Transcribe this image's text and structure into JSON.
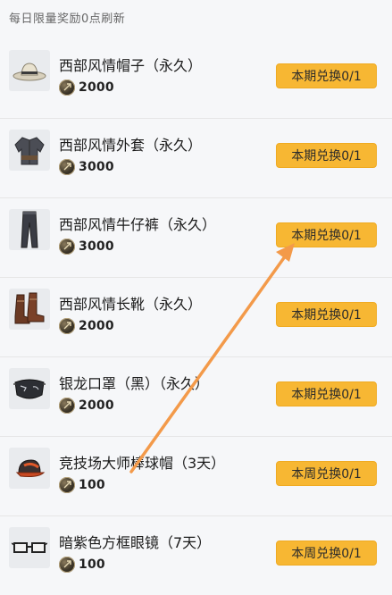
{
  "header": {
    "notice": "每日限量奖励0点刷新"
  },
  "items": [
    {
      "name": "西部风情帽子（永久）",
      "price": "2000",
      "button_label": "本期兑换0/1",
      "icon": "cowboy-hat-icon"
    },
    {
      "name": "西部风情外套（永久）",
      "price": "3000",
      "button_label": "本期兑换0/1",
      "icon": "jacket-icon"
    },
    {
      "name": "西部风情牛仔裤（永久）",
      "price": "3000",
      "button_label": "本期兑换0/1",
      "icon": "jeans-icon"
    },
    {
      "name": "西部风情长靴（永久）",
      "price": "2000",
      "button_label": "本期兑换0/1",
      "icon": "boots-icon"
    },
    {
      "name": "银龙口罩（黑）（永久）",
      "price": "2000",
      "button_label": "本期兑换0/1",
      "icon": "mask-icon"
    },
    {
      "name": "竞技场大师棒球帽（3天）",
      "price": "100",
      "button_label": "本周兑换0/1",
      "icon": "baseball-cap-icon"
    },
    {
      "name": "暗紫色方框眼镜（7天）",
      "price": "100",
      "button_label": "本周兑换0/1",
      "icon": "glasses-icon"
    }
  ],
  "colors": {
    "button": "#f7b733",
    "arrow": "#f39a4a",
    "background": "#f6f7f9"
  }
}
